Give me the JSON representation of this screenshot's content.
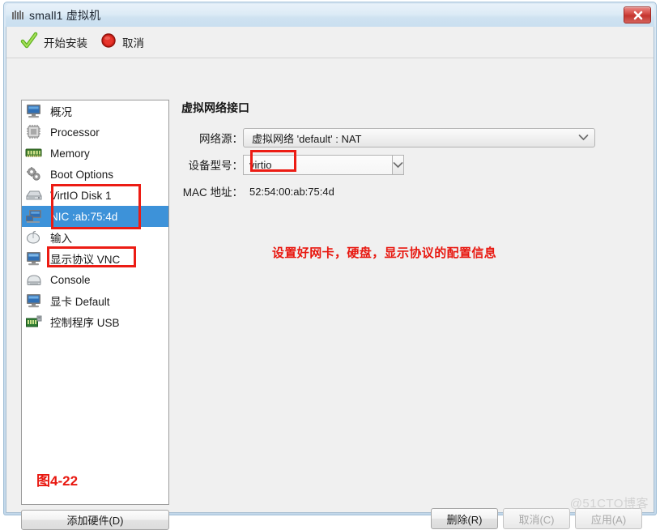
{
  "window": {
    "title": "small1 虚拟机",
    "title_icon": "vm-icon",
    "close_icon": "close-icon",
    "frame_color": "#c3d8ea",
    "close_button_color": "#c4352f"
  },
  "toolbar": {
    "items": [
      {
        "label": "开始安装",
        "icon": "green-check-icon",
        "name": "begin-installation-button"
      },
      {
        "label": "取消",
        "icon": "red-stop-icon",
        "name": "cancel-install-button"
      }
    ]
  },
  "hardware_list": {
    "selected_index": 5,
    "selected_color": "#3d92d9",
    "items": [
      {
        "label": "概况",
        "icon": "monitor-icon"
      },
      {
        "label": "Processor",
        "icon": "cpu-chip-icon"
      },
      {
        "label": "Memory",
        "icon": "memory-module-icon"
      },
      {
        "label": "Boot Options",
        "icon": "gears-icon"
      },
      {
        "label": "VirtIO Disk 1",
        "icon": "hard-disk-icon"
      },
      {
        "label": "NIC :ab:75:4d",
        "icon": "network-card-icon"
      },
      {
        "label": "输入",
        "icon": "mouse-icon"
      },
      {
        "label": "显示协议 VNC",
        "icon": "display-icon"
      },
      {
        "label": "Console",
        "icon": "console-icon"
      },
      {
        "label": "显卡 Default",
        "icon": "video-card-icon"
      },
      {
        "label": "控制程序 USB",
        "icon": "usb-controller-icon"
      }
    ],
    "figure_caption": "图4-22",
    "add_hardware_label": "添加硬件(D)"
  },
  "detail_panel": {
    "heading": "虚拟网络接口",
    "network_source": {
      "label": "网络源：",
      "value": "虚拟网络 'default' : NAT",
      "icon": "chevron-down-icon"
    },
    "device_model": {
      "label": "设备型号：",
      "value": "virtio",
      "icon": "chevron-down-icon"
    },
    "mac_address": {
      "label": "MAC 地址：",
      "value": "52:54:00:ab:75:4d"
    }
  },
  "annotation": {
    "note": "设置好网卡，硬盘，显示协议的配置信息",
    "note_color": "#e8170f",
    "highlight_color": "#ec1c14",
    "highlight_targets": [
      "VirtIO Disk 1 / NIC :ab:75:4d",
      "显示协议 VNC",
      "virtio"
    ]
  },
  "button_bar": {
    "buttons": [
      {
        "label": "删除(R)",
        "name": "remove-button",
        "disabled": false
      },
      {
        "label": "取消(C)",
        "name": "cancel-button",
        "disabled": true
      },
      {
        "label": "应用(A)",
        "name": "apply-button",
        "disabled": true
      }
    ]
  },
  "watermark": {
    "text": "@51CTO博客"
  }
}
